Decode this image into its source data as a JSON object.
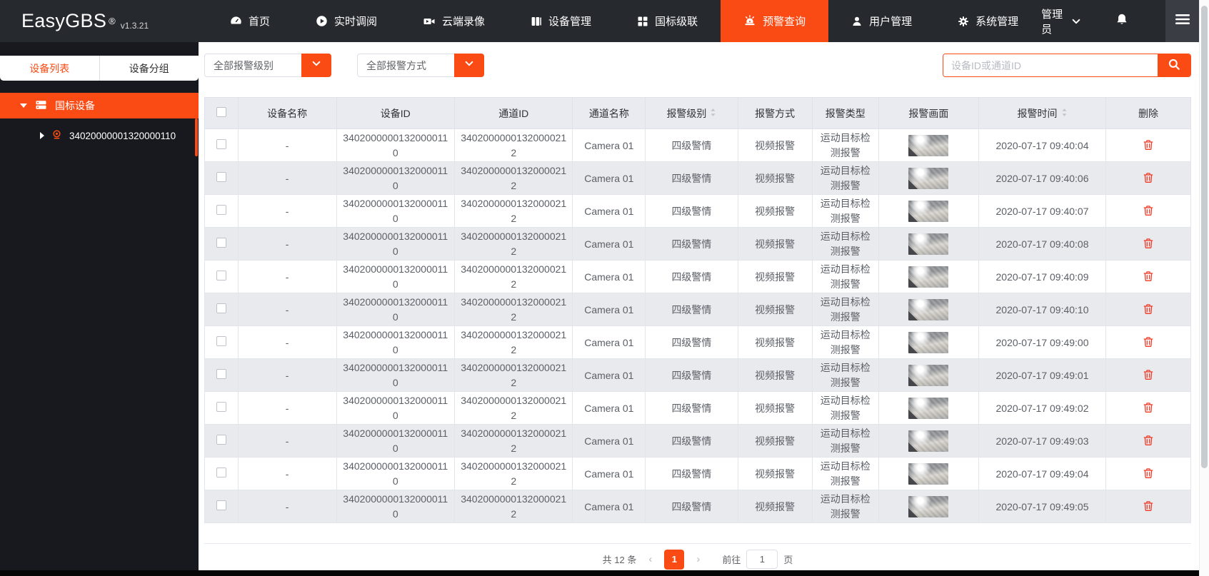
{
  "colors": {
    "accent": "#fb4b14",
    "danger": "#ee3b28",
    "topbar_bg": "#26292e",
    "sidebar_bg": "#17191e",
    "table_header_bg": "#e9ebf0",
    "row_stripe_bg": "#e9eaee"
  },
  "topbar": {
    "logo": "EasyGBS",
    "registered_mark": "®",
    "version": "v1.3.21",
    "items": [
      {
        "label": "首页",
        "icon": "dashboard-icon",
        "active": false
      },
      {
        "label": "实时调阅",
        "icon": "play-icon",
        "active": false
      },
      {
        "label": "云端录像",
        "icon": "video-camera-icon",
        "active": false
      },
      {
        "label": "设备管理",
        "icon": "devices-icon",
        "active": false
      },
      {
        "label": "国标级联",
        "icon": "cascade-icon",
        "active": false
      },
      {
        "label": "预警查询",
        "icon": "alarm-icon",
        "active": true
      },
      {
        "label": "用户管理",
        "icon": "user-icon",
        "active": false
      },
      {
        "label": "系统管理",
        "icon": "gear-icon",
        "active": false
      }
    ],
    "admin_label": "管理员"
  },
  "sidebar": {
    "tabs": [
      {
        "label": "设备列表",
        "active": true
      },
      {
        "label": "设备分组",
        "active": false
      }
    ],
    "root_label": "国标设备",
    "device_id": "34020000001320000110"
  },
  "filters": {
    "level_selected": "全部报警级别",
    "method_selected": "全部报警方式",
    "search_placeholder": "设备ID或通道ID"
  },
  "table": {
    "headers": [
      {
        "label": "",
        "checkbox": true
      },
      {
        "label": "设备名称"
      },
      {
        "label": "设备ID"
      },
      {
        "label": "通道ID"
      },
      {
        "label": "通道名称"
      },
      {
        "label": "报警级别",
        "sortable": true
      },
      {
        "label": "报警方式"
      },
      {
        "label": "报警类型"
      },
      {
        "label": "报警画面"
      },
      {
        "label": "报警时间",
        "sortable": true
      },
      {
        "label": "删除"
      }
    ],
    "rows": [
      {
        "device_name": "-",
        "device_id": "34020000001320000110",
        "channel_id": "34020000001320000212",
        "channel_name": "Camera 01",
        "alarm_level": "四级警情",
        "alarm_method": "视频报警",
        "alarm_type": "运动目标检测报警",
        "alarm_time": "2020-07-17 09:40:04"
      },
      {
        "device_name": "-",
        "device_id": "34020000001320000110",
        "channel_id": "34020000001320000212",
        "channel_name": "Camera 01",
        "alarm_level": "四级警情",
        "alarm_method": "视频报警",
        "alarm_type": "运动目标检测报警",
        "alarm_time": "2020-07-17 09:40:06"
      },
      {
        "device_name": "-",
        "device_id": "34020000001320000110",
        "channel_id": "34020000001320000212",
        "channel_name": "Camera 01",
        "alarm_level": "四级警情",
        "alarm_method": "视频报警",
        "alarm_type": "运动目标检测报警",
        "alarm_time": "2020-07-17 09:40:07"
      },
      {
        "device_name": "-",
        "device_id": "34020000001320000110",
        "channel_id": "34020000001320000212",
        "channel_name": "Camera 01",
        "alarm_level": "四级警情",
        "alarm_method": "视频报警",
        "alarm_type": "运动目标检测报警",
        "alarm_time": "2020-07-17 09:40:08"
      },
      {
        "device_name": "-",
        "device_id": "34020000001320000110",
        "channel_id": "34020000001320000212",
        "channel_name": "Camera 01",
        "alarm_level": "四级警情",
        "alarm_method": "视频报警",
        "alarm_type": "运动目标检测报警",
        "alarm_time": "2020-07-17 09:40:09"
      },
      {
        "device_name": "-",
        "device_id": "34020000001320000110",
        "channel_id": "34020000001320000212",
        "channel_name": "Camera 01",
        "alarm_level": "四级警情",
        "alarm_method": "视频报警",
        "alarm_type": "运动目标检测报警",
        "alarm_time": "2020-07-17 09:40:10"
      },
      {
        "device_name": "-",
        "device_id": "34020000001320000110",
        "channel_id": "34020000001320000212",
        "channel_name": "Camera 01",
        "alarm_level": "四级警情",
        "alarm_method": "视频报警",
        "alarm_type": "运动目标检测报警",
        "alarm_time": "2020-07-17 09:49:00"
      },
      {
        "device_name": "-",
        "device_id": "34020000001320000110",
        "channel_id": "34020000001320000212",
        "channel_name": "Camera 01",
        "alarm_level": "四级警情",
        "alarm_method": "视频报警",
        "alarm_type": "运动目标检测报警",
        "alarm_time": "2020-07-17 09:49:01"
      },
      {
        "device_name": "-",
        "device_id": "34020000001320000110",
        "channel_id": "34020000001320000212",
        "channel_name": "Camera 01",
        "alarm_level": "四级警情",
        "alarm_method": "视频报警",
        "alarm_type": "运动目标检测报警",
        "alarm_time": "2020-07-17 09:49:02"
      },
      {
        "device_name": "-",
        "device_id": "34020000001320000110",
        "channel_id": "34020000001320000212",
        "channel_name": "Camera 01",
        "alarm_level": "四级警情",
        "alarm_method": "视频报警",
        "alarm_type": "运动目标检测报警",
        "alarm_time": "2020-07-17 09:49:03"
      },
      {
        "device_name": "-",
        "device_id": "34020000001320000110",
        "channel_id": "34020000001320000212",
        "channel_name": "Camera 01",
        "alarm_level": "四级警情",
        "alarm_method": "视频报警",
        "alarm_type": "运动目标检测报警",
        "alarm_time": "2020-07-17 09:49:04"
      },
      {
        "device_name": "-",
        "device_id": "34020000001320000110",
        "channel_id": "34020000001320000212",
        "channel_name": "Camera 01",
        "alarm_level": "四级警情",
        "alarm_method": "视频报警",
        "alarm_type": "运动目标检测报警",
        "alarm_time": "2020-07-17 09:49:05"
      }
    ]
  },
  "pagination": {
    "total_label": "共 12 条",
    "current_page": "1",
    "goto_label": "前往",
    "goto_value": "1",
    "page_unit": "页"
  }
}
